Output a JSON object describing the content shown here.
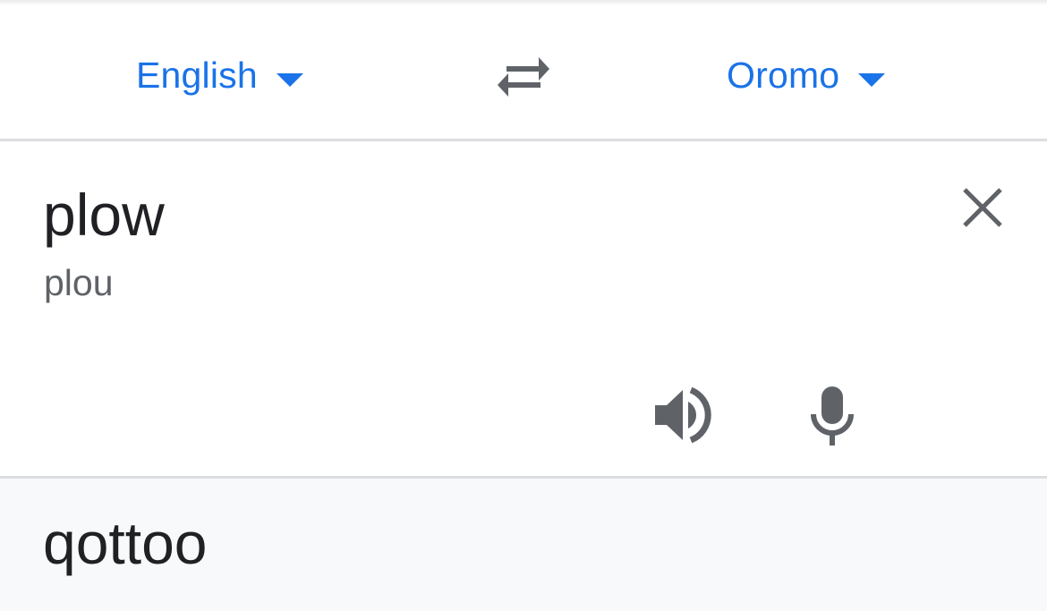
{
  "language_bar": {
    "source_language": "English",
    "target_language": "Oromo",
    "source_caret_icon": "caret-down-icon",
    "target_caret_icon": "caret-down-icon",
    "swap_icon": "swap-arrows-icon"
  },
  "source": {
    "text": "plow",
    "transliteration": "plou",
    "clear_icon": "close-icon",
    "speak_icon": "speaker-icon",
    "mic_icon": "microphone-icon"
  },
  "result": {
    "text": "qottoo"
  },
  "colors": {
    "accent": "#1a73e8",
    "text_primary": "#202124",
    "text_secondary": "#5f6368",
    "icon_gray": "#5f6368",
    "divider": "#dcdde0",
    "result_background": "#f8f9fa"
  }
}
